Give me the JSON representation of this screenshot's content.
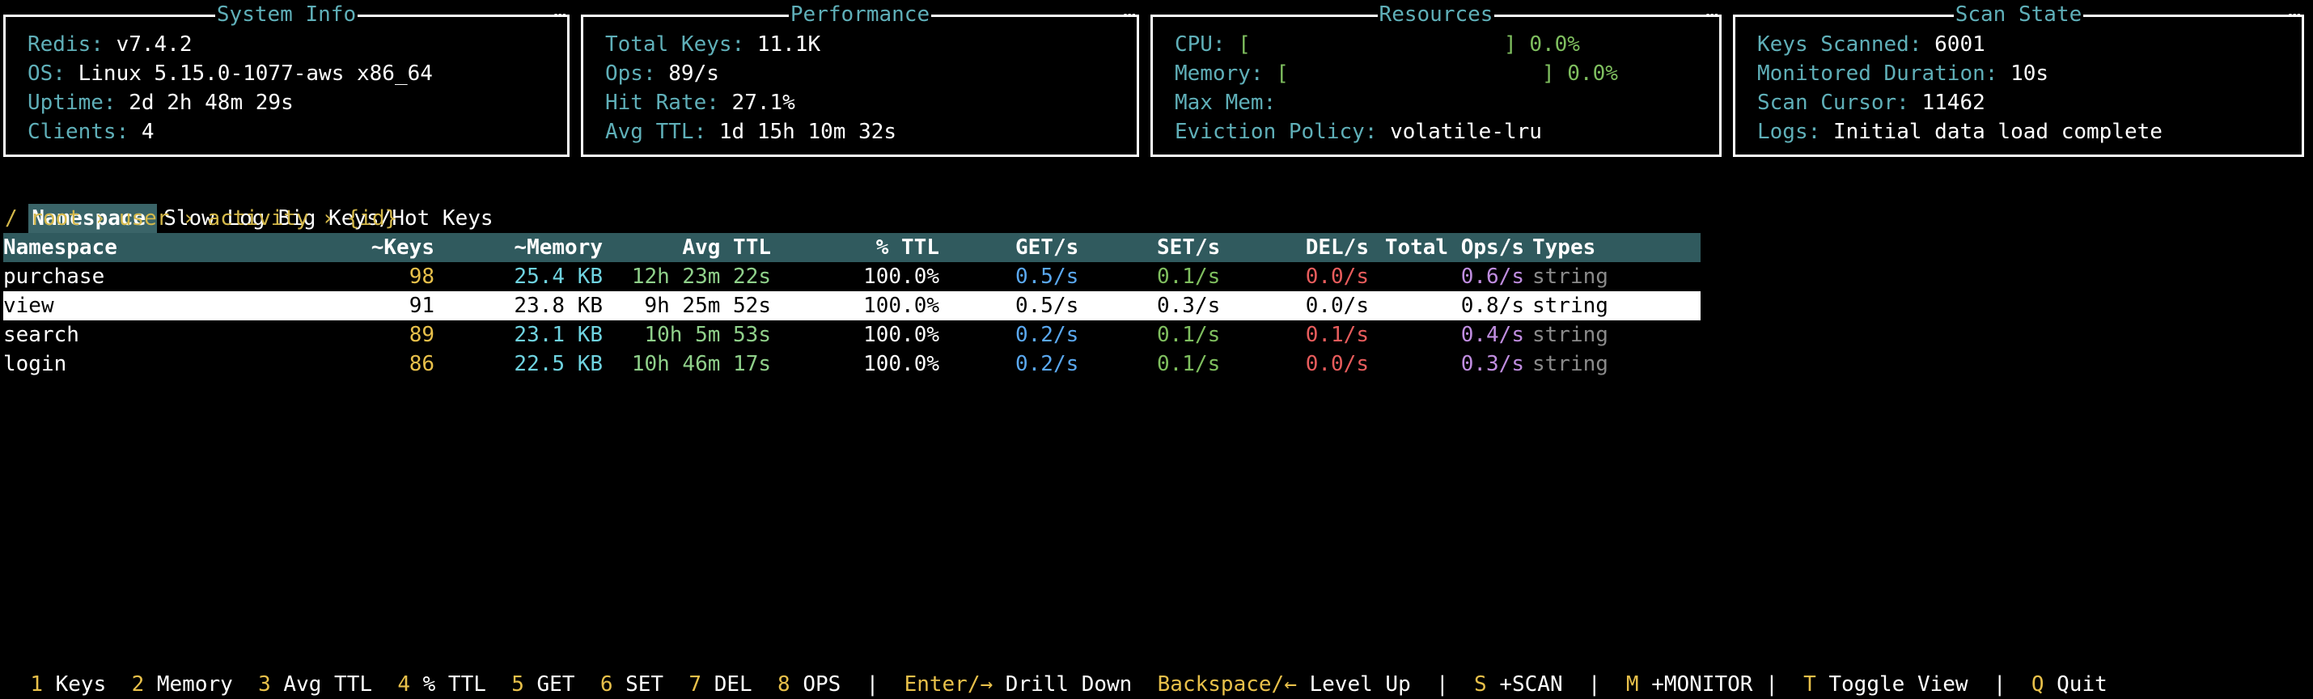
{
  "panels": {
    "system": {
      "title": "System Info",
      "rows": [
        {
          "k": "Redis:",
          "v": "v7.4.2"
        },
        {
          "k": "OS:",
          "v": "Linux 5.15.0-1077-aws x86_64"
        },
        {
          "k": "Uptime:",
          "v": "2d 2h 48m 29s"
        },
        {
          "k": "Clients:",
          "v": "4"
        }
      ]
    },
    "performance": {
      "title": "Performance",
      "rows": [
        {
          "k": "Total Keys:",
          "v": "11.1K"
        },
        {
          "k": "Ops:",
          "v": "89/s"
        },
        {
          "k": "Hit Rate:",
          "v": "27.1%"
        },
        {
          "k": "Avg TTL:",
          "v": "1d 15h 10m 32s"
        }
      ]
    },
    "resources": {
      "title": "Resources",
      "cpu_label": "CPU:",
      "cpu_bar": "[                    ]",
      "cpu_value": "0.0%",
      "mem_label": "Memory:",
      "mem_bar": "[                    ]",
      "mem_value": "0.0%",
      "maxmem_label": "Max Mem:",
      "maxmem_value": "",
      "eviction_label": "Eviction Policy:",
      "eviction_value": "volatile-lru"
    },
    "scan": {
      "title": "Scan State",
      "rows": [
        {
          "k": "Keys Scanned:",
          "v": "6001"
        },
        {
          "k": "Monitored Duration:",
          "v": "10s"
        },
        {
          "k": "Scan Cursor:",
          "v": "11462"
        },
        {
          "k": "Logs:",
          "v": "Initial data load complete"
        }
      ]
    }
  },
  "tabs": [
    "Namespace",
    "Slow Log",
    "Big Keys/Hot Keys"
  ],
  "breadcrumb": "/ root › user › activity › {id}",
  "table": {
    "headers": [
      "Namespace",
      "~Keys",
      "~Memory",
      "Avg TTL",
      "% TTL",
      "GET/s",
      "SET/s",
      "DEL/s",
      "Total Ops/s",
      "Types"
    ],
    "rows": [
      [
        "purchase",
        "98",
        "25.4 KB",
        "12h 23m 22s",
        "100.0%",
        "0.5/s",
        "0.1/s",
        "0.0/s",
        "0.6/s",
        "string"
      ],
      [
        "view",
        "91",
        "23.8 KB",
        "9h 25m 52s",
        "100.0%",
        "0.5/s",
        "0.3/s",
        "0.0/s",
        "0.8/s",
        "string"
      ],
      [
        "search",
        "89",
        "23.1 KB",
        "10h 5m 53s",
        "100.0%",
        "0.2/s",
        "0.1/s",
        "0.1/s",
        "0.4/s",
        "string"
      ],
      [
        "login",
        "86",
        "22.5 KB",
        "10h 46m 17s",
        "100.0%",
        "0.2/s",
        "0.1/s",
        "0.0/s",
        "0.3/s",
        "string"
      ]
    ],
    "selected_index": 1
  },
  "footer": [
    {
      "key": "1",
      "label": "Keys"
    },
    {
      "key": "2",
      "label": "Memory"
    },
    {
      "key": "3",
      "label": "Avg TTL"
    },
    {
      "key": "4",
      "label": "% TTL"
    },
    {
      "key": "5",
      "label": "GET"
    },
    {
      "key": "6",
      "label": "SET"
    },
    {
      "key": "7",
      "label": "DEL"
    },
    {
      "key": "8",
      "label": "OPS"
    },
    {
      "key": "Enter/→",
      "label": "Drill Down"
    },
    {
      "key": "Backspace/←",
      "label": "Level Up"
    },
    {
      "key": "S",
      "label": "+SCAN"
    },
    {
      "key": "M",
      "label": "+MONITOR"
    },
    {
      "key": "T",
      "label": "Toggle View"
    },
    {
      "key": "Q",
      "label": "Quit"
    }
  ],
  "footer_separator": "|",
  "panel_menu_glyph": "…",
  "colors": {
    "label": "#5fafb8",
    "header_bg": "#305a5e",
    "active_tab_bg": "#3a6468",
    "keys": "#e8c04a",
    "memory": "#6fd3e0",
    "ttl": "#8fd08a",
    "get": "#5aa8f0",
    "set": "#7fbf5f",
    "del": "#e85c5c",
    "ops": "#c08de0",
    "types": "#8a8a8a"
  }
}
